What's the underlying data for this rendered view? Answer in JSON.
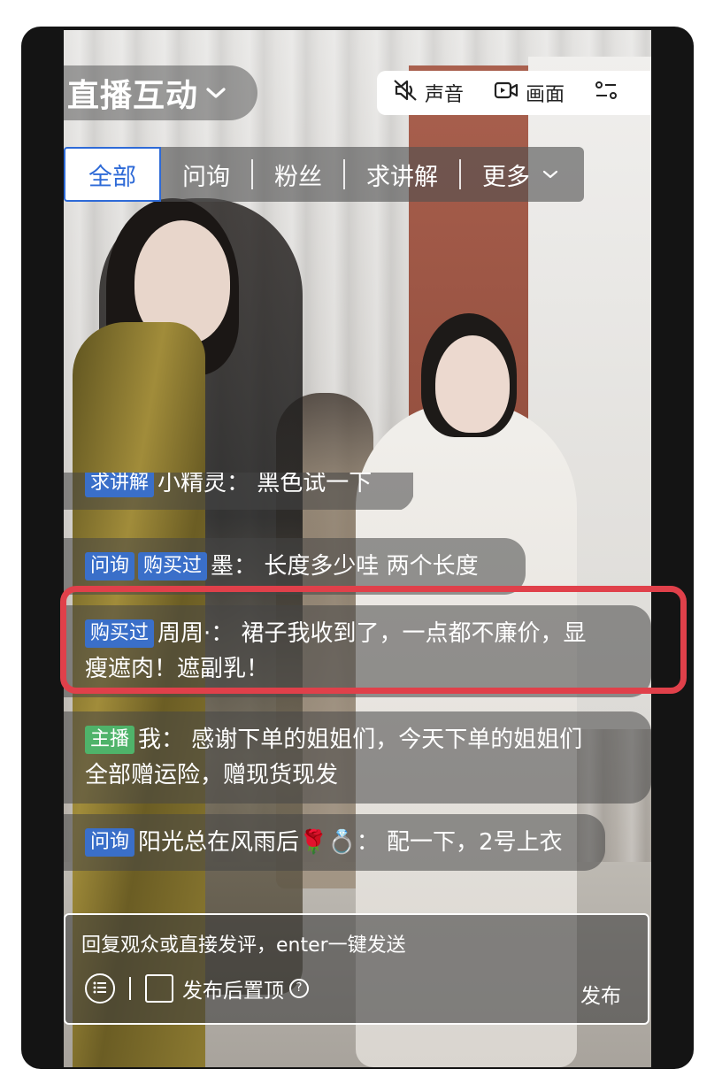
{
  "header": {
    "title": "直播互动",
    "toolbar": {
      "sound_label": "声音",
      "video_label": "画面"
    }
  },
  "tabs": [
    {
      "label": "全部",
      "active": true
    },
    {
      "label": "问询"
    },
    {
      "label": "粉丝"
    },
    {
      "label": "求讲解"
    },
    {
      "label": "更多"
    }
  ],
  "comments": [
    {
      "badges": [
        "求讲解"
      ],
      "user": "小精灵：",
      "text": "黑色试一下"
    },
    {
      "badges": [
        "问询",
        "购买过"
      ],
      "user": "墨：",
      "text": "长度多少哇 两个长度"
    },
    {
      "badges": [
        "购买过"
      ],
      "user": "周周·：",
      "text": "裙子我收到了，一点都不廉价，显",
      "text2": "瘦遮肉！遮副乳！"
    },
    {
      "badges": [
        "主播"
      ],
      "user": "我：",
      "text": "感谢下单的姐姐们，今天下单的姐姐们",
      "text2": "全部赠运险，赠现货现发"
    },
    {
      "badges": [
        "问询"
      ],
      "user": "阳光总在风雨后🌹💍：",
      "text": "配一下，2号上衣"
    }
  ],
  "input": {
    "placeholder": "回复观众或直接发评，enter一键发送",
    "pin_label": "发布后置顶",
    "help_icon": "?",
    "publish_label": "发布"
  },
  "colors": {
    "accent_blue": "#2e6ad7",
    "badge_blue": "#3a6fc9",
    "badge_green": "#4fb36a",
    "highlight_red": "#e0404a"
  }
}
